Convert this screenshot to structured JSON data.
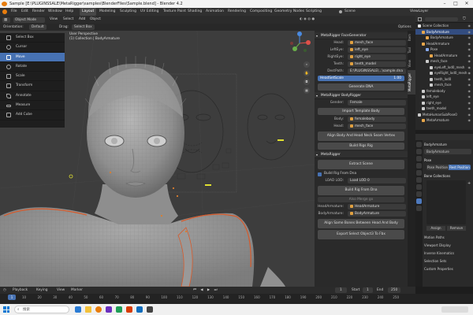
{
  "window": {
    "title": "Sample [E:\\PLUGINSSALE\\MetaRigger\\samples\\BlenderFiles\\Sample.blend] - Blender 4.2"
  },
  "menu": [
    "File",
    "Edit",
    "Render",
    "Window",
    "Help"
  ],
  "workspaces": [
    "Layout",
    "Modeling",
    "Sculpting",
    "UV Editing",
    "Texture Paint",
    "Shading",
    "Animation",
    "Rendering",
    "Compositing",
    "Geometry Nodes",
    "Scripting"
  ],
  "scene": {
    "label": "Scene",
    "view_layer": "ViewLayer"
  },
  "viewport_header": {
    "mode": "Object Mode",
    "view": "View",
    "select": "Select",
    "add": "Add",
    "object": "Object",
    "orientation_label": "Orientation:",
    "orientation": "Default",
    "drag_label": "Drag:",
    "drag": "Select Box",
    "options": "Options"
  },
  "viewport": {
    "perspective": "User Perspective",
    "collection": "(1) Collection | BodyArmature"
  },
  "toolbox": [
    {
      "label": "Select Box",
      "icon": "select-box-icon"
    },
    {
      "label": "Cursor",
      "icon": "cursor-icon"
    },
    {
      "label": "Move",
      "icon": "move-icon",
      "active": true
    },
    {
      "label": "Rotate",
      "icon": "rotate-icon"
    },
    {
      "label": "Scale",
      "icon": "scale-icon"
    },
    {
      "label": "Transform",
      "icon": "transform-icon"
    },
    {
      "label": "Annotate",
      "icon": "annotate-icon"
    },
    {
      "label": "Measure",
      "icon": "measure-icon"
    },
    {
      "label": "Add Cube",
      "icon": "add-cube-icon"
    }
  ],
  "npanel": {
    "face_generator": {
      "title": "MetaRigger FaceGenerator",
      "rows": [
        {
          "label": "Head:",
          "value": "mesh_face"
        },
        {
          "label": "LeftEye:",
          "value": "left_eye"
        },
        {
          "label": "RightEye:",
          "value": "right_eye"
        },
        {
          "label": "Teeth:",
          "value": "teeth_model"
        },
        {
          "label": "DestPath:",
          "value": "E:\\PLUGINSSALE\\...\\sample.dna"
        }
      ],
      "head_scale_label": "HeadSetScale",
      "head_scale_value": "1.00",
      "generate_button": "Generate DNA"
    },
    "body_rigger": {
      "title": "MetaRigger BodyRigger",
      "gender_label": "Gender:",
      "gender": "Female",
      "import_button": "Import Template Body",
      "body_label": "Body:",
      "body": "femalebody",
      "head_label": "Head:",
      "head": "mesh_face",
      "align_button": "Align Body And Head Neck Seam Vertex",
      "build_button": "Build Rigs Rig"
    },
    "metarigger": {
      "title": "MetaRigger",
      "extract_button": "Extract Scene",
      "build_from_dna_check": "Build Rig From Dna",
      "load_lod_label": "LOAD LOD:",
      "load_lod": "Load LOD 0",
      "build_button": "Build Rig From Dna",
      "add_merge_button": "Also Merge go",
      "head_armature_label": "HeadArmature:",
      "head_armature": "HeadArmature",
      "body_armature_label": "BodyArmature:",
      "body_armature": "BodyArmature",
      "align_bones_button": "Align Same Bones Between Head And Body",
      "export_button": "Export Select Object3 To Fbx"
    }
  },
  "ntabs": [
    "Item",
    "Tool",
    "View",
    "MetaRigger"
  ],
  "outliner": {
    "title": "Scene Collection",
    "rows": [
      {
        "label": "Scene Collection",
        "indent": 0,
        "color": "#e6e6e6"
      },
      {
        "label": "BodyArmature",
        "indent": 1,
        "color": "#e7a64a",
        "sel": true
      },
      {
        "label": "BodyArmature",
        "indent": 2,
        "color": "#e7a64a"
      },
      {
        "label": "HeadArmature",
        "indent": 1,
        "color": "#e7a64a"
      },
      {
        "label": "Pose",
        "indent": 2,
        "color": "#88aaee"
      },
      {
        "label": "HeadArmature",
        "indent": 3,
        "color": "#e7a64a"
      },
      {
        "label": "mesh_face",
        "indent": 2,
        "color": "#cccccc"
      },
      {
        "label": "eyeLeft_lod0_mesh",
        "indent": 3,
        "color": "#cccccc"
      },
      {
        "label": "eyeRight_lod0_mesh",
        "indent": 3,
        "color": "#cccccc"
      },
      {
        "label": "teeth_lod0",
        "indent": 3,
        "color": "#cccccc"
      },
      {
        "label": "mesh_face",
        "indent": 3,
        "color": "#cccccc"
      },
      {
        "label": "femalebody",
        "indent": 1,
        "color": "#cccccc"
      },
      {
        "label": "left_eye",
        "indent": 1,
        "color": "#cccccc"
      },
      {
        "label": "right_eye",
        "indent": 1,
        "color": "#cccccc"
      },
      {
        "label": "teeth_model",
        "indent": 1,
        "color": "#cccccc"
      },
      {
        "label": "MetaHumanSubPose0",
        "indent": 0,
        "color": "#cccccc"
      },
      {
        "label": "MetaArmature",
        "indent": 1,
        "color": "#e7a64a"
      }
    ]
  },
  "properties": {
    "object": "BodyArmature",
    "data": "BodyArmature",
    "pose_section": "Pose",
    "pose_position": "Pose Position",
    "rest_position": "Rest Position",
    "bone_collections": "Bone Collections",
    "assign": "Assign",
    "remove": "Remove",
    "sections": [
      "Motion Paths",
      "Viewport Display",
      "Inverse Kinematics",
      "Selection Sets",
      "Custom Properties"
    ]
  },
  "timeline": {
    "playback": "Playback",
    "keying": "Keying",
    "view": "View",
    "marker": "Marker",
    "current_frame": "1",
    "start_label": "Start",
    "start": "1",
    "end_label": "End",
    "end": "250",
    "ticks": [
      "10",
      "20",
      "30",
      "40",
      "50",
      "60",
      "70",
      "80",
      "90",
      "100",
      "110",
      "120",
      "130",
      "140",
      "150",
      "160",
      "170",
      "180",
      "190",
      "200",
      "210",
      "220",
      "230",
      "240",
      "250"
    ]
  },
  "taskbar": {
    "search": "搜索"
  },
  "colors": {
    "accent": "#4772b3",
    "orange": "#e87d0d",
    "panel": "#2a2a2a"
  }
}
